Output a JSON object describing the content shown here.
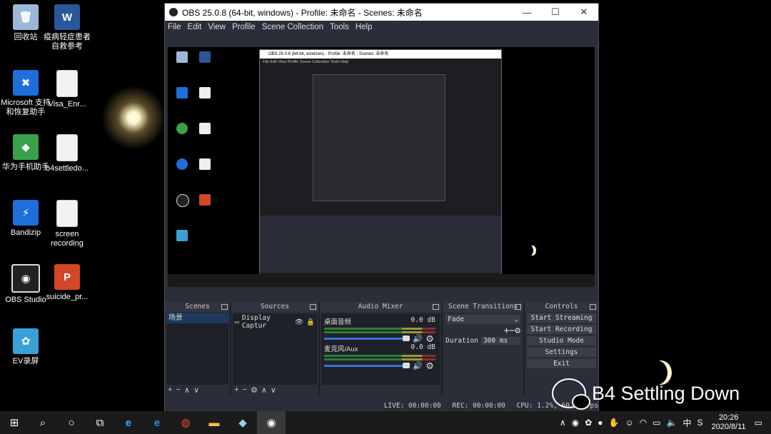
{
  "desktop": {
    "icons": [
      {
        "label": "回收站",
        "icon": "recycle-bin-icon",
        "kind": "bin",
        "glyph": "🗑"
      },
      {
        "label": "疫病轻症患者自救参考",
        "icon": "word-document-icon",
        "kind": "word",
        "glyph": "W"
      },
      {
        "label": "Microsoft 支持和恢复助手",
        "icon": "tools-icon",
        "kind": "blue",
        "glyph": "✖"
      },
      {
        "label": "Visa_Enr...",
        "icon": "document-icon",
        "kind": "doc",
        "glyph": ""
      },
      {
        "label": "华为手机助手",
        "icon": "huawei-assistant-icon",
        "kind": "green",
        "glyph": "◆"
      },
      {
        "label": "b4settledo...",
        "icon": "document-icon",
        "kind": "doc",
        "glyph": ""
      },
      {
        "label": "Bandizip",
        "icon": "bandizip-icon",
        "kind": "blue",
        "glyph": "⚡"
      },
      {
        "label": "screen recording",
        "icon": "document-icon",
        "kind": "doc",
        "glyph": ""
      },
      {
        "label": "OBS Studio",
        "icon": "obs-studio-icon",
        "kind": "obsic",
        "glyph": "◉"
      },
      {
        "label": "suicide_pr...",
        "icon": "powerpoint-icon",
        "kind": "ppt",
        "glyph": "P"
      },
      {
        "label": "EV录屏",
        "icon": "ev-recorder-icon",
        "kind": "evic",
        "glyph": "✿"
      }
    ]
  },
  "window": {
    "title": "OBS 25.0.8 (64-bit, windows) - Profile: 未命名 - Scenes: 未命名",
    "minimize": "—",
    "maximize": "☐",
    "close": "✕"
  },
  "menu": [
    "File",
    "Edit",
    "View",
    "Profile",
    "Scene Collection",
    "Tools",
    "Help"
  ],
  "docks": {
    "scenes": {
      "title": "Scenes",
      "items": [
        "场景"
      ]
    },
    "sources": {
      "title": "Sources",
      "items": [
        "Display Captur"
      ]
    },
    "mixer": {
      "title": "Audio Mixer",
      "channels": [
        {
          "name": "桌面音频",
          "db": "0.0 dB"
        },
        {
          "name": "麦克风/Aux",
          "db": "0.0 dB"
        }
      ]
    },
    "transitions": {
      "title": "Scene Transitions",
      "selected": "Fade",
      "duration_label": "Duration",
      "duration_value": "300 ms"
    },
    "controls": {
      "title": "Controls",
      "buttons": [
        "Start Streaming",
        "Start Recording",
        "Studio Mode",
        "Settings",
        "Exit"
      ]
    }
  },
  "status": {
    "live": "LIVE: 00:00:00",
    "rec": "REC: 00:00:00",
    "cpu": "CPU: 1.2%, 60.00 fps"
  },
  "taskbar": {
    "time": "20:26",
    "date": "2020/8/11",
    "ime": "中"
  },
  "watermark": {
    "text": "B4 Settling Down"
  }
}
